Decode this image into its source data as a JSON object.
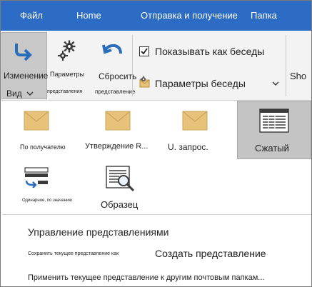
{
  "menu": {
    "tabs": [
      {
        "label": "Файл"
      },
      {
        "label": "Home"
      },
      {
        "label": "Отправка и получение"
      },
      {
        "label": "Папка"
      }
    ]
  },
  "ribbon": {
    "change_view": {
      "label": "Изменение",
      "sublabel": "Вид"
    },
    "view_settings": {
      "label": "Параметры",
      "sublabel": "представления"
    },
    "reset_view": {
      "label": "Сбросить",
      "sublabel": "представление"
    },
    "show_as_conversations": {
      "label": "Показывать как беседы",
      "checked": true
    },
    "conversation_settings": {
      "label": "Параметры беседы"
    },
    "overflow_label": "Sho"
  },
  "gallery": {
    "items": [
      {
        "label": "По получателю",
        "icon": "envelope-icon"
      },
      {
        "label": "Утверждение R...",
        "icon": "envelope-icon"
      },
      {
        "label": "U. запрос.",
        "icon": "envelope-icon"
      },
      {
        "label": "Сжатый",
        "icon": "compact-list-icon",
        "selected": true
      },
      {
        "label": "Одинарное, по значению",
        "icon": "single-line-icon"
      },
      {
        "label": "Образец",
        "icon": "preview-icon"
      }
    ]
  },
  "menu_commands": {
    "manage_views": "Управление представлениями",
    "save_current_view": "Сохранить текущее представление как",
    "create_view": "Создать представление",
    "apply_view": "Применить текущее представление к другим почтовым папкам..."
  },
  "colors": {
    "menubar": "#2c6cc4",
    "envelope": "#e8c27a",
    "accent_blue": "#2a6ebb"
  }
}
